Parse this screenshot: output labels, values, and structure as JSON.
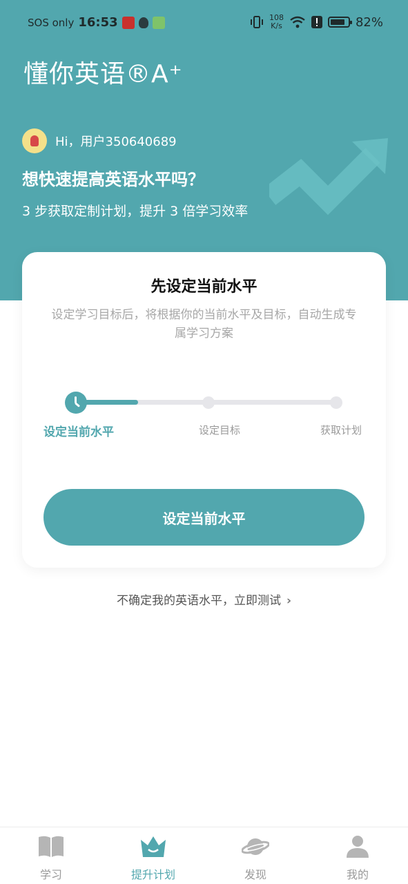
{
  "status_bar": {
    "sos": "SOS only",
    "time": "16:53",
    "net_speed_value": "108",
    "net_speed_unit": "K/s",
    "battery_percent": "82%",
    "battery_level": 0.82,
    "icons": [
      "news-app-icon",
      "shield-icon",
      "wechat-app-icon",
      "vibrate-icon",
      "wifi-icon",
      "alert-icon",
      "battery-icon"
    ]
  },
  "header": {
    "app_title": "懂你英语®A⁺",
    "greeting": "Hi，用户350640689",
    "headline": "想快速提高英语水平吗？",
    "subline": "3 步获取定制计划，提升 3 倍学习效率"
  },
  "card": {
    "title": "先设定当前水平",
    "description": "设定学习目标后，将根据你的当前水平及目标，自动生成专属学习方案",
    "steps": [
      {
        "label": "设定当前水平",
        "active": true
      },
      {
        "label": "设定目标",
        "active": false
      },
      {
        "label": "获取计划",
        "active": false
      }
    ],
    "cta_label": "设定当前水平"
  },
  "test_link": {
    "label": "不确定我的英语水平，立即测试"
  },
  "tabbar": {
    "tabs": [
      {
        "label": "学习",
        "icon": "book-icon",
        "active": false
      },
      {
        "label": "提升计划",
        "icon": "crown-icon",
        "active": true
      },
      {
        "label": "发现",
        "icon": "planet-icon",
        "active": false
      },
      {
        "label": "我的",
        "icon": "profile-icon",
        "active": false
      }
    ]
  },
  "colors": {
    "accent": "#52a7ae",
    "inactive": "#9a9a9a",
    "track": "#e6e6ea"
  }
}
